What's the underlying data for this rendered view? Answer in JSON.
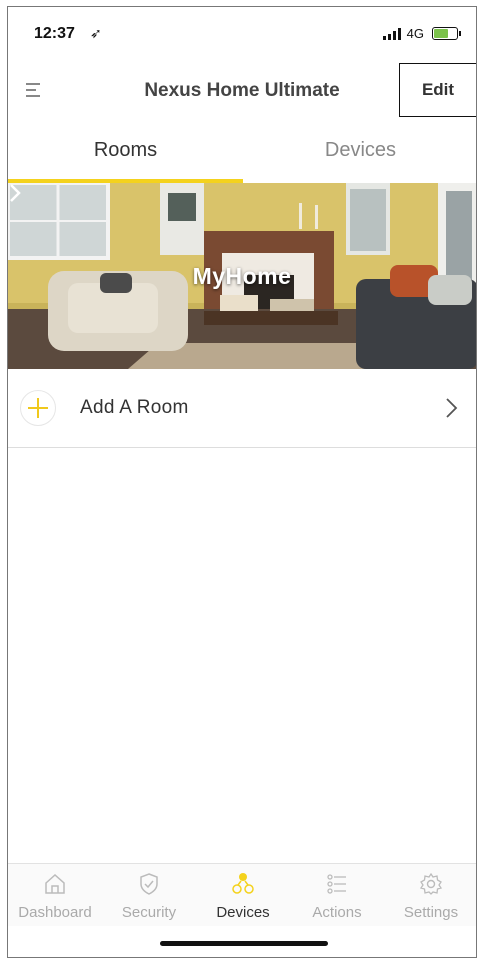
{
  "status_bar": {
    "time": "12:37",
    "network": "4G"
  },
  "header": {
    "title": "Nexus Home Ultimate",
    "edit_label": "Edit"
  },
  "tabs": {
    "rooms": "Rooms",
    "devices": "Devices",
    "active": "Rooms"
  },
  "home_banner": {
    "label": "MyHome"
  },
  "add_room": {
    "label": "Add A Room"
  },
  "bottom_nav": {
    "items": [
      {
        "label": "Dashboard",
        "icon": "home-icon"
      },
      {
        "label": "Security",
        "icon": "shield-icon"
      },
      {
        "label": "Devices",
        "icon": "devices-icon"
      },
      {
        "label": "Actions",
        "icon": "actions-icon"
      },
      {
        "label": "Settings",
        "icon": "gear-icon"
      }
    ],
    "active": "Devices"
  },
  "colors": {
    "accent": "#f4d21d",
    "battery": "#7bc24b"
  }
}
